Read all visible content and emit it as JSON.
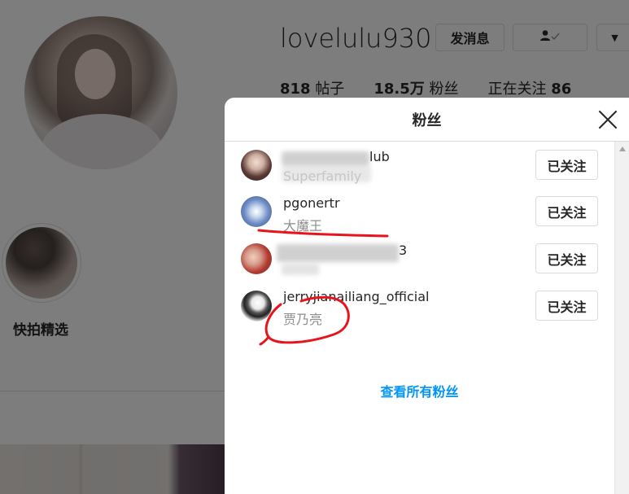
{
  "profile": {
    "username": "lovelulu930",
    "message_button": "发消息",
    "following_icon": "person-check-icon",
    "more_icon": "chevron-down-icon",
    "stats": [
      {
        "value": "818",
        "label": "帖子"
      },
      {
        "value": "18.5万",
        "label": "粉丝"
      },
      {
        "label": "正在关注",
        "value": "86"
      }
    ],
    "highlight_label": "快拍精选"
  },
  "modal": {
    "title": "粉丝",
    "close_icon": "close-icon",
    "items": [
      {
        "handle": "lub",
        "fullname": "Superfamily",
        "button": "已关注"
      },
      {
        "handle": "pgonertr",
        "fullname": "大魔王",
        "button": "已关注"
      },
      {
        "handle": "3",
        "fullname": "",
        "button": "已关注"
      },
      {
        "handle": "jerryjianailiang_official",
        "fullname": "贾乃亮",
        "button": "已关注"
      }
    ],
    "see_all": "查看所有粉丝"
  },
  "colors": {
    "link": "#0095f6",
    "annotation": "#e8141c"
  }
}
